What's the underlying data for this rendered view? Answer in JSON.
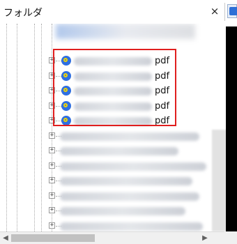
{
  "panel": {
    "title": "フォルダ",
    "close_glyph": "×"
  },
  "tree": {
    "highlight_color": "#e01e1e",
    "expander_glyph": "+",
    "highlighted_rows": [
      {
        "label_suffix": "pdf"
      },
      {
        "label_suffix": "pdf"
      },
      {
        "label_suffix": "pdf"
      },
      {
        "label_suffix": "pdf"
      },
      {
        "label_suffix": "pdf"
      }
    ]
  },
  "scrollbar": {
    "left_arrow": "◀",
    "right_arrow": "▶"
  },
  "icons": {
    "close": "close-icon",
    "file": "file-app-icon",
    "expander": "plus-box-icon",
    "scroll_left": "scroll-left-icon",
    "scroll_right": "scroll-right-icon"
  }
}
